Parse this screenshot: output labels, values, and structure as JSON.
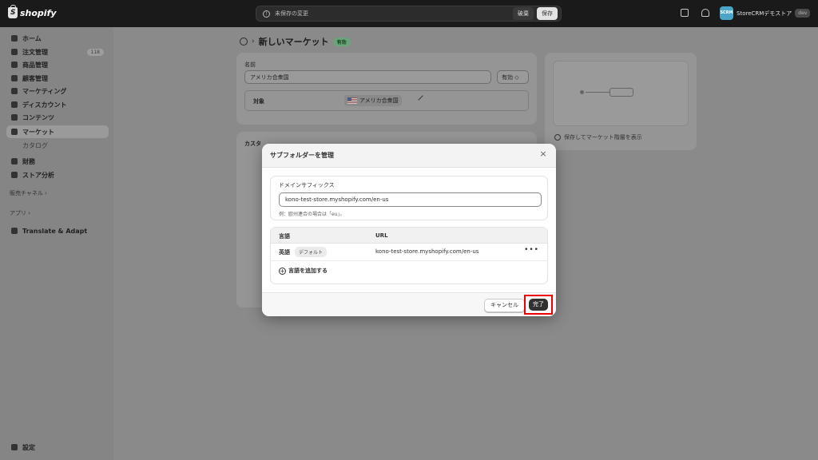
{
  "topbar": {
    "brand": "shopify",
    "unsaved_message": "未保存の変更",
    "discard_label": "破棄",
    "save_label": "保存",
    "store_avatar": "SCRM",
    "store_name": "StoreCRMデモストア",
    "store_badge": "dev"
  },
  "sidebar": {
    "items": [
      {
        "label": "ホーム",
        "icon": "home-icon"
      },
      {
        "label": "注文管理",
        "icon": "inbox-icon",
        "badge": "118"
      },
      {
        "label": "商品管理",
        "icon": "tag-icon"
      },
      {
        "label": "顧客管理",
        "icon": "person-icon"
      },
      {
        "label": "マーケティング",
        "icon": "target-icon"
      },
      {
        "label": "ディスカウント",
        "icon": "discount-icon"
      },
      {
        "label": "コンテンツ",
        "icon": "content-icon"
      },
      {
        "label": "マーケット",
        "icon": "globe-icon"
      }
    ],
    "sub_item": "カタログ",
    "items2": [
      {
        "label": "財務",
        "icon": "bank-icon"
      },
      {
        "label": "ストア分析",
        "icon": "chart-icon"
      }
    ],
    "sales_channels": "販売チャネル ›",
    "apps": "アプリ ›",
    "app_item": "Translate & Adapt",
    "settings": "設定"
  },
  "page": {
    "breadcrumb_sep": "›",
    "title": "新しいマーケット",
    "status_badge": "有効",
    "name_label": "名前",
    "name_value": "アメリカ合衆国",
    "status_select": "有効 ◇",
    "target_label": "対象",
    "target_value": "アメリカ合衆国",
    "custom_label": "カスタ",
    "preview_hint": "保存してマーケット階層を表示"
  },
  "modal": {
    "title": "サブフォルダーを管理",
    "close": "×",
    "domain_label": "ドメインサフィックス",
    "domain_value": "kono-test-store.myshopify.com/en-us",
    "domain_help": "例：欧州連合の場合は「eu」。",
    "col_language": "言語",
    "col_url": "URL",
    "rows": [
      {
        "language": "英語",
        "badge": "デフォルト",
        "url": "kono-test-store.myshopify.com/en-us",
        "more": "•••"
      }
    ],
    "add_language": "言語を追加する",
    "cancel_label": "キャンセル",
    "done_label": "完了"
  },
  "colors": {
    "highlight": "#e00000",
    "primary_button": "#303030",
    "success_badge": "#6aa57a"
  }
}
